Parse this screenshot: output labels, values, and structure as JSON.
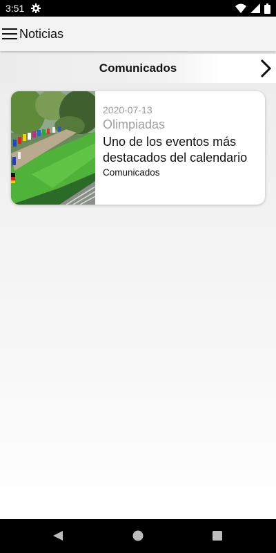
{
  "status_bar": {
    "time": "3:51",
    "icons": [
      "settings-icon",
      "wifi-icon",
      "signal-icon",
      "battery-icon"
    ]
  },
  "app_bar": {
    "title": "Noticias",
    "menu_icon": "hamburger-menu-icon"
  },
  "category_bar": {
    "label": "Comunicados",
    "next_icon": "chevron-right-icon"
  },
  "news": [
    {
      "date": "2020-07-13",
      "category": "Olimpiadas",
      "title": "Uno de los eventos más destacados del calendario",
      "tag": "Comunicados",
      "thumbnail": "flags-parade-image"
    }
  ],
  "nav_bar": {
    "buttons": [
      "back-icon",
      "home-icon",
      "recents-icon"
    ]
  },
  "colors": {
    "app_bar_bg": "#f3f3f3",
    "muted_text": "#9e9e9e",
    "status_bar_bg": "#000000"
  }
}
